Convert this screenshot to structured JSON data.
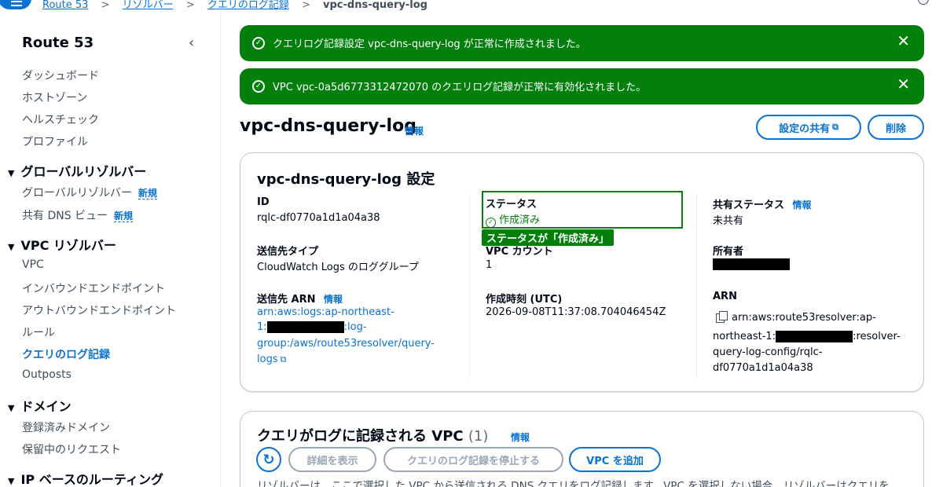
{
  "breadcrumb": {
    "items": [
      "Route 53",
      "リゾルバー",
      "クエリのログ記録"
    ],
    "current": "vpc-dns-query-log",
    "separator": ">"
  },
  "sidebar": {
    "title": "Route 53",
    "collapse_icon": "chevron-left-icon",
    "top_items": [
      "ダッシュボード",
      "ホストゾーン",
      "ヘルスチェック",
      "プロファイル"
    ],
    "sections": [
      {
        "label": "グローバルリゾルバー",
        "items": [
          {
            "label": "グローバルリゾルバー",
            "badge": "新規"
          },
          {
            "label": "共有 DNS ビュー",
            "badge": "新規"
          }
        ]
      },
      {
        "label": "VPC リゾルバー",
        "items": [
          {
            "label": "VPC"
          },
          {
            "label": "インバウンドエンドポイント"
          },
          {
            "label": "アウトバウンドエンドポイント"
          },
          {
            "label": "ルール"
          },
          {
            "label": "クエリのログ記録",
            "active": true
          },
          {
            "label": "Outposts"
          }
        ]
      },
      {
        "label": "ドメイン",
        "items": [
          {
            "label": "登録済みドメイン"
          },
          {
            "label": "保留中のリクエスト"
          }
        ]
      },
      {
        "label": "IP ベースのルーティング",
        "items": []
      }
    ]
  },
  "flashes": [
    "クエリログ記録設定 vpc-dns-query-log が正常に作成されました。",
    "VPC vpc-0a5d6773312472070 のクエリログ記録が正常に有効化されました。"
  ],
  "page": {
    "title": "vpc-dns-query-log",
    "info": "情報",
    "share_button": "設定の共有",
    "delete_button": "削除"
  },
  "settings": {
    "title": "vpc-dns-query-log 設定",
    "id_label": "ID",
    "id_value": "rqlc-df0770a1d1a04a38",
    "dest_type_label": "送信先タイプ",
    "dest_type_value": "CloudWatch Logs のロググループ",
    "dest_arn_label": "送信先 ARN",
    "dest_arn_info": "情報",
    "dest_arn_line1": "arn:aws:logs:ap-northeast-",
    "dest_arn_line2a": "1:",
    "dest_arn_line2b": ":log-",
    "dest_arn_line3": "group:/aws/route53resolver/query-",
    "dest_arn_line4": "logs",
    "status_label": "ステータス",
    "status_value": "作成済み",
    "status_annotation": "ステータスが「作成済み」",
    "vpc_count_label": "VPC カウント",
    "vpc_count_value": "1",
    "created_label": "作成時刻 (UTC)",
    "created_value": "2026-09-08T11:37:08.704046454Z",
    "share_status_label": "共有ステータス",
    "share_status_info": "情報",
    "share_status_value": "未共有",
    "owner_label": "所有者",
    "arn_label": "ARN",
    "arn_line1": "arn:aws:route53resolver:ap-",
    "arn_line2a": "northeast-1:",
    "arn_line2b": ":resolver-",
    "arn_line3": "query-log-config/rqlc-",
    "arn_line4": "df0770a1d1a04a38"
  },
  "vpc_section": {
    "title": "クエリがログに記録される VPC",
    "count": "(1)",
    "info": "情報",
    "detail_button": "詳細を表示",
    "stop_button": "クエリのログ記録を停止する",
    "add_button": "VPC を追加",
    "description": "リゾルバーは、ここで選択した VPC から送信される DNS クエリをログ記録します。VPC を選択しない場合、リゾルバーはクエリを"
  },
  "colors": {
    "accent": "#0972d3",
    "success": "#037f0c",
    "text": "#000716",
    "muted": "#414d5c"
  }
}
